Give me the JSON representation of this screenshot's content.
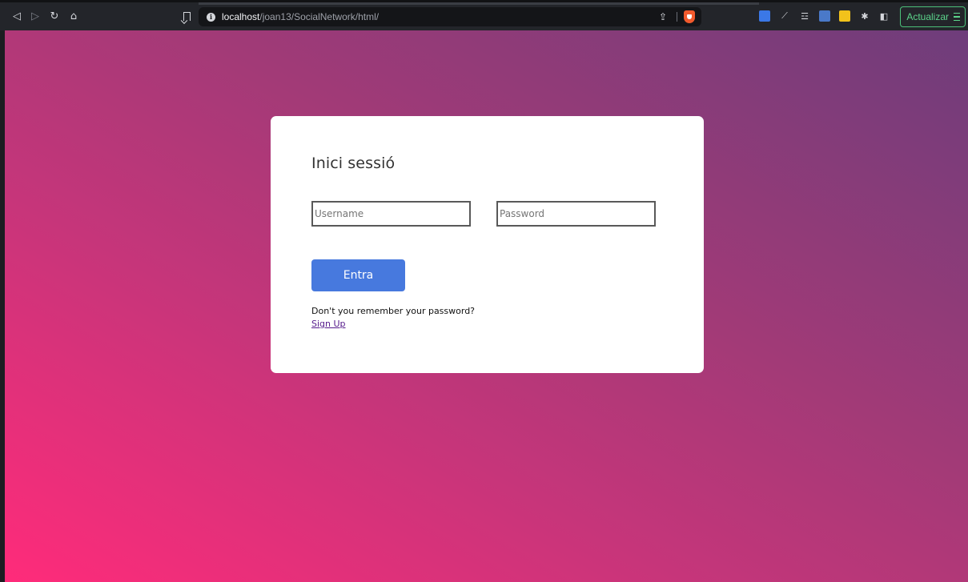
{
  "browser": {
    "url_host": "localhost",
    "url_path": "/joan13/SocialNetwork/html/",
    "update_label": "Actualizar"
  },
  "login": {
    "title": "Inici sessió",
    "username_placeholder": "Username",
    "password_placeholder": "Password",
    "submit_label": "Entra",
    "forgot_text": "Don't you remember your password?",
    "signup_label": "Sign Up"
  },
  "colors": {
    "submit_button": "#4779de",
    "link": "#551a8b",
    "update_accent": "#5cd48b"
  }
}
